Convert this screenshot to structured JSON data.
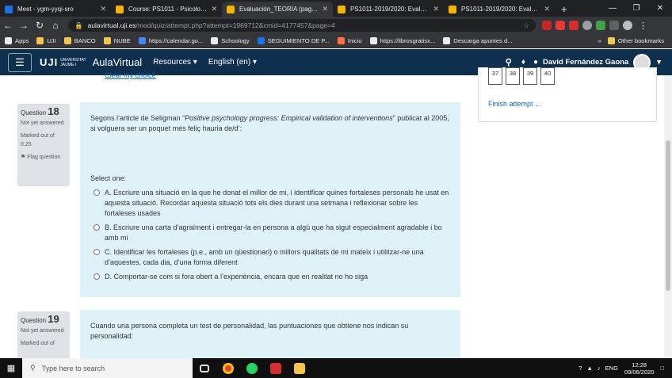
{
  "browser": {
    "tabs": [
      {
        "title": "Meet - ygm-yyqi-sro",
        "color": "#1a73e8",
        "active": false
      },
      {
        "title": "Course: PS1011 - Psicología de",
        "color": "#f4b400",
        "active": false
      },
      {
        "title": "Evaluación_TEORÍA (page 5 of",
        "color": "#f4b400",
        "active": true
      },
      {
        "title": "PS1011-2019/2020: Evaluación",
        "color": "#f4b400",
        "active": false
      },
      {
        "title": "PS1011-2019/2020: Evaluación",
        "color": "#f4b400",
        "active": false
      }
    ],
    "url_host": "aulavirtual.uji.es",
    "url_path": "/mod/quiz/attempt.php?attempt=1969712&cmid=4177457&page=4",
    "bookmarks": [
      {
        "label": "Apps",
        "color": "#e8eaed"
      },
      {
        "label": "UJI",
        "color": "#f3c74f"
      },
      {
        "label": "BANCO",
        "color": "#f3c74f"
      },
      {
        "label": "NUBE",
        "color": "#f3c74f"
      },
      {
        "label": "https://calendar.go...",
        "color": "#4285f4"
      },
      {
        "label": "Schoology",
        "color": "#e8eaed"
      },
      {
        "label": "SEGUIMIENTO DE P...",
        "color": "#1a73e8"
      },
      {
        "label": "Inicio",
        "color": "#ff7043"
      },
      {
        "label": "https://librosgratisx...",
        "color": "#e8eaed"
      },
      {
        "label": "Descarga apuntes d...",
        "color": "#e8eaed"
      }
    ],
    "more_bookmarks": "»",
    "other_bookmarks": "Other bookmarks"
  },
  "moodle": {
    "brand": "UJI",
    "brand_sub1": "UNIVERSITAT",
    "brand_sub2": "JAUME·I",
    "app_name": "AulaVirtual",
    "menu_resources": "Resources",
    "menu_language": "English (en)",
    "user_name": "David Fernández Gaona"
  },
  "quiz": {
    "prev_link": "Clear my choice",
    "q18": {
      "label": "Question",
      "number": "18",
      "state": "Not yet answered",
      "marks": "Marked out of 0.25",
      "flag": "Flag question",
      "text_pre": "Segons l’article de Seligman “",
      "text_italic": "Positive psychology progress: Empirical validation of interventions",
      "text_post": "” publicat al 2005, si volguera ser un poquet més feliç hauria de/d’:",
      "select_one": "Select one:",
      "options": [
        "A. Escriure una situació en la que he donat el millor de mi, i identificar quines fortaleses personals he usat en aquesta situació. Recordar aquesta situació tots els dies durant una setmana i reflexionar sobre les fortaleses usades",
        "B. Escriure una carta d’agraïment i entregar-la en persona a algú que ha sigut especialment agradable i bo amb mi",
        "C. Identificar les fortaleses (p.e., amb un qüestionari) o millors qualitats de mi mateix i utilitzar-ne una d’aquestes, cada dia, d’una forma diferent",
        "D. Comportar-se com si fora obert a l’experiència, encara que en realitat no ho siga"
      ]
    },
    "q19": {
      "label": "Question",
      "number": "19",
      "state": "Not yet answered",
      "marks": "Marked out of",
      "text": "Cuando una persona completa un test de personalidad, las puntuaciones que obtiene nos indican su personalidad:"
    },
    "navigation": {
      "buttons": [
        "37",
        "38",
        "39",
        "40"
      ],
      "finish": "Finish attempt ..."
    }
  },
  "taskbar": {
    "search_placeholder": "Type here to search",
    "lang": "ENG",
    "time": "12:28",
    "date": "09/06/2020"
  }
}
